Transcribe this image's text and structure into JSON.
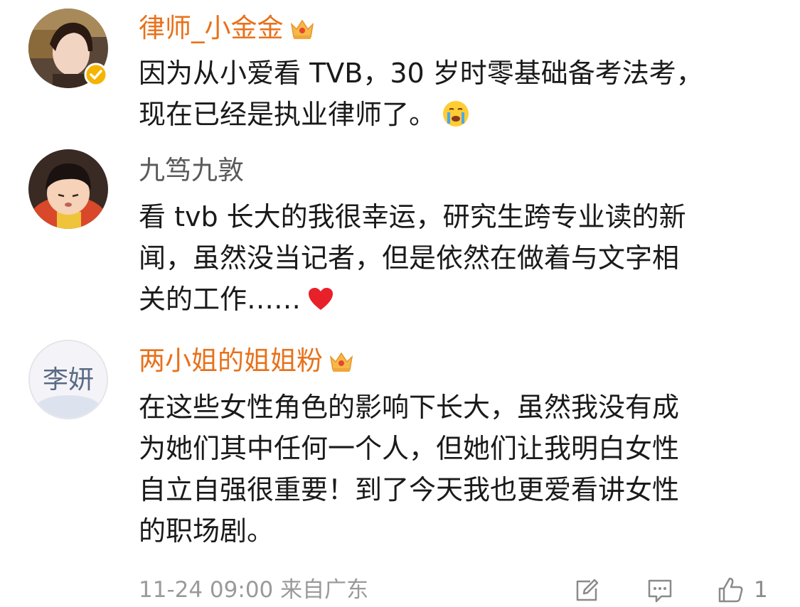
{
  "comments": [
    {
      "username": "律师_小金金",
      "badge": "crown-vip-icon",
      "verified": true,
      "lines": [
        "因为从小爱看 TVB，30 岁时零基础备考法考，",
        "现在已经是执业律师了。"
      ],
      "trailing_emoji": "crying-face-emoji-icon"
    },
    {
      "username": "九笃九敦",
      "lines": [
        "看 tvb 长大的我很幸运，研究生跨专业读的新",
        "闻，虽然没当记者，但是依然在做着与文字相",
        "关的工作……"
      ],
      "trailing_emoji": "red-heart-emoji-icon"
    },
    {
      "username": "两小姐的姐姐粉",
      "badge": "crown-vip-icon",
      "avatar_text": "李妍",
      "lines": [
        "在这些女性角色的影响下长大，虽然我没有成",
        "为她们其中任何一个人，但她们让我明白女性",
        "自立自强很重要！到了今天我也更爱看讲女性",
        "的职场剧。"
      ]
    }
  ],
  "footer": {
    "timestamp": "11-24 09:00 来自广东",
    "like_count": "1"
  },
  "colors": {
    "vip_name": "#e8711a",
    "plain_name": "#5a5a5a",
    "text": "#1a1a1a",
    "meta": "#9a9a9a"
  }
}
